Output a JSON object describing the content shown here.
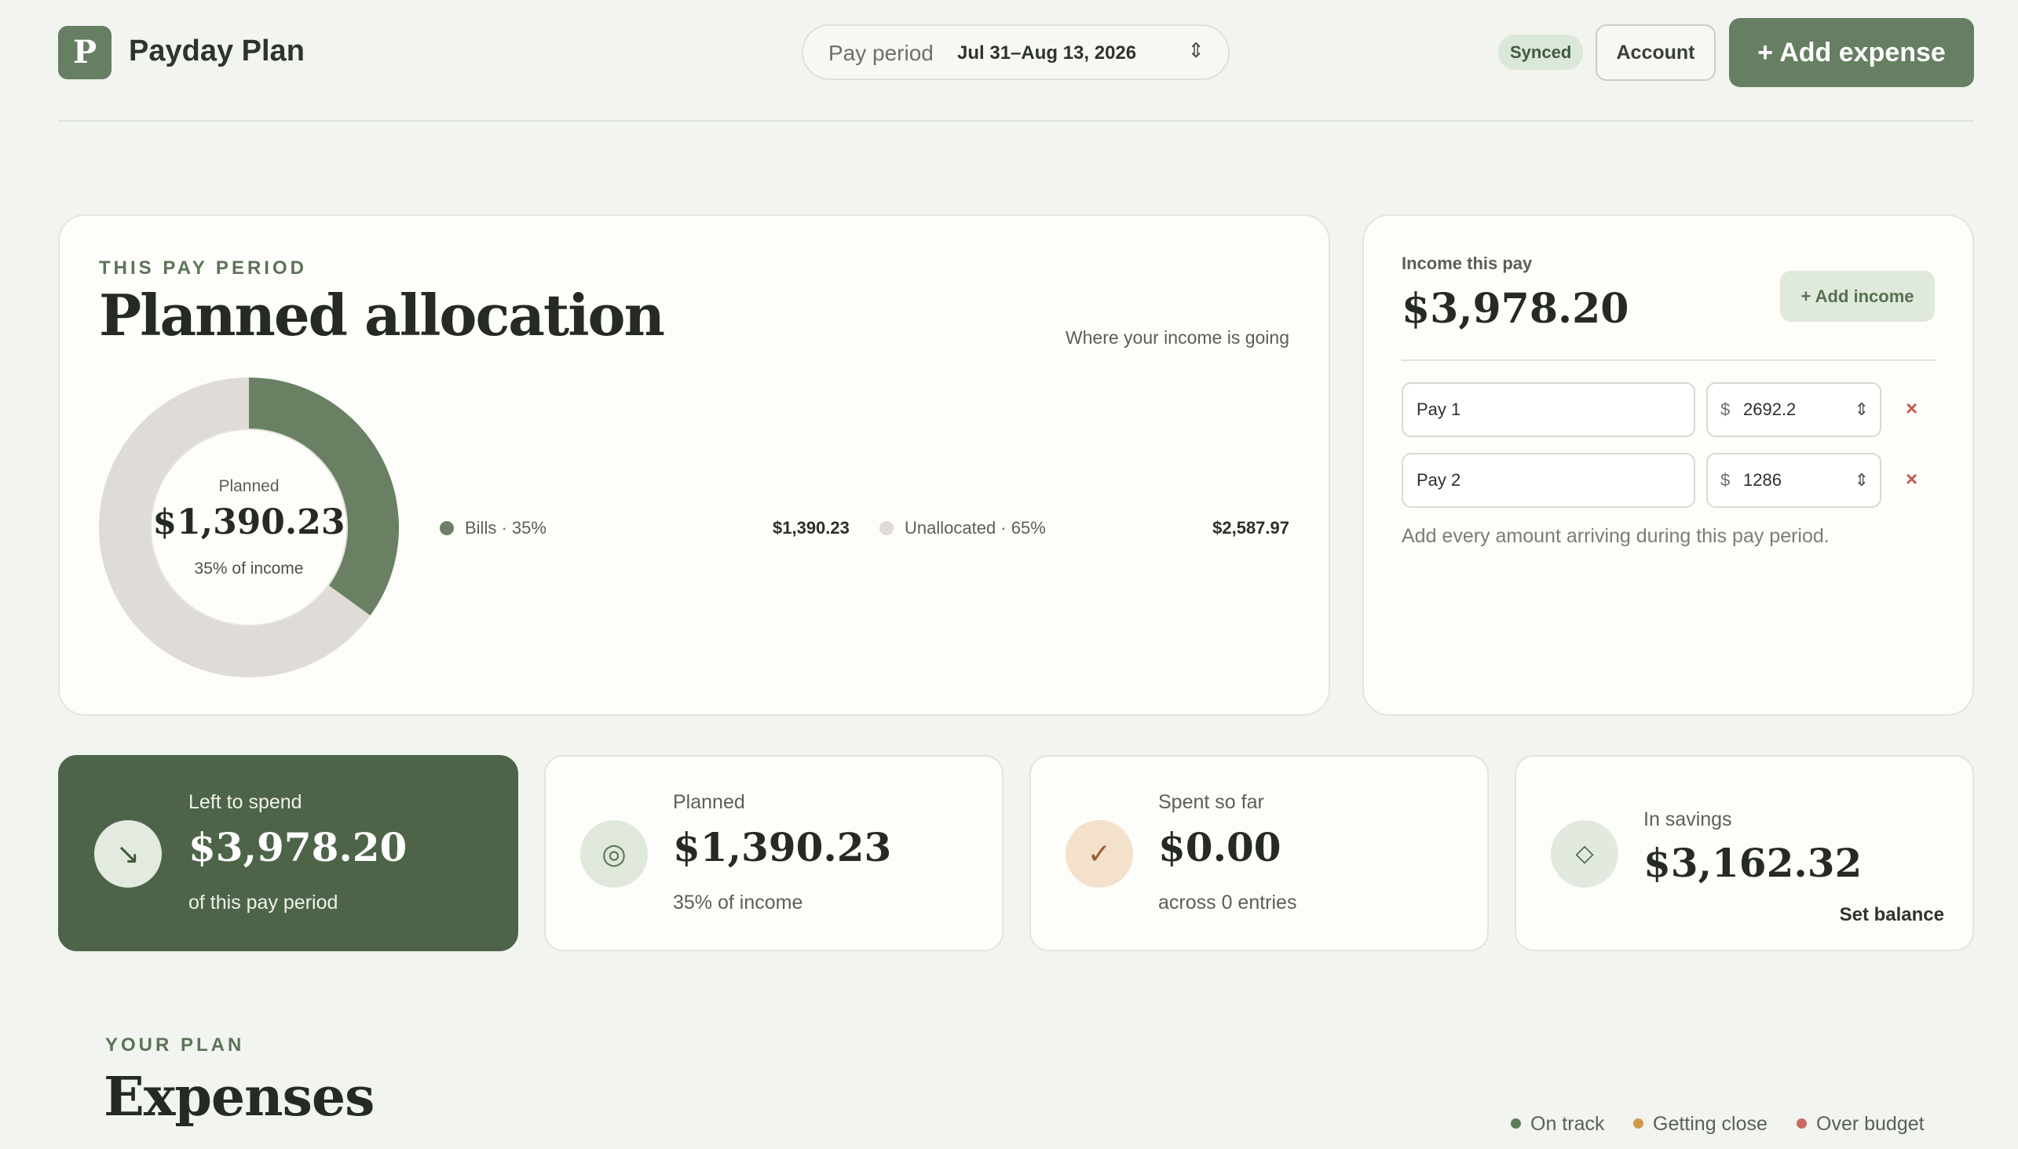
{
  "app": {
    "logo_letter": "P",
    "name": "Payday Plan"
  },
  "header": {
    "period_label": "Pay period",
    "period_value": "Jul 31–Aug 13, 2026",
    "synced_badge": "Synced",
    "account_label": "Account",
    "add_expense_label": "+ Add expense"
  },
  "allocation": {
    "eyebrow": "THIS PAY PERIOD",
    "title": "Planned allocation",
    "subtitle": "Where your income is going",
    "donut_label": "Planned",
    "donut_value": "$1,390.23",
    "donut_sub": "35% of income",
    "segments": [
      {
        "label": "Bills · 35%",
        "amount": "$1,390.23",
        "fraction": 0.35,
        "color": "#6a8063"
      },
      {
        "label": "Unallocated · 65%",
        "amount": "$2,587.97",
        "fraction": 0.65,
        "color": "#dfdbd7"
      }
    ]
  },
  "income": {
    "label": "Income this pay",
    "total": "$3,978.20",
    "add_label": "+ Add income",
    "currency": "$",
    "pays": [
      {
        "name": "Pay 1",
        "amount": "2692.2"
      },
      {
        "name": "Pay 2",
        "amount": "1286"
      }
    ],
    "remove_glyph": "×",
    "help": "Add every amount arriving during this pay period."
  },
  "stats": {
    "left": {
      "label": "Left to spend",
      "value": "$3,978.20",
      "sub": "of this pay period",
      "icon": "arrow-down-right-icon"
    },
    "planned": {
      "label": "Planned",
      "value": "$1,390.23",
      "sub": "35% of income",
      "icon": "target-icon"
    },
    "spent": {
      "label": "Spent so far",
      "value": "$0.00",
      "sub": "across 0 entries",
      "icon": "check-icon"
    },
    "savings": {
      "label": "In savings",
      "value": "$3,162.32",
      "action": "Set balance",
      "icon": "diamond-icon"
    }
  },
  "plan": {
    "eyebrow": "YOUR PLAN",
    "title": "Expenses",
    "legend": [
      {
        "label": "On track",
        "color": "#5f7a5a"
      },
      {
        "label": "Getting close",
        "color": "#d19a4b"
      },
      {
        "label": "Over budget",
        "color": "#c96a60"
      }
    ]
  },
  "colors": {
    "accent": "#667e61",
    "dark_card": "#4e6448",
    "background": "#f1f4ef"
  }
}
